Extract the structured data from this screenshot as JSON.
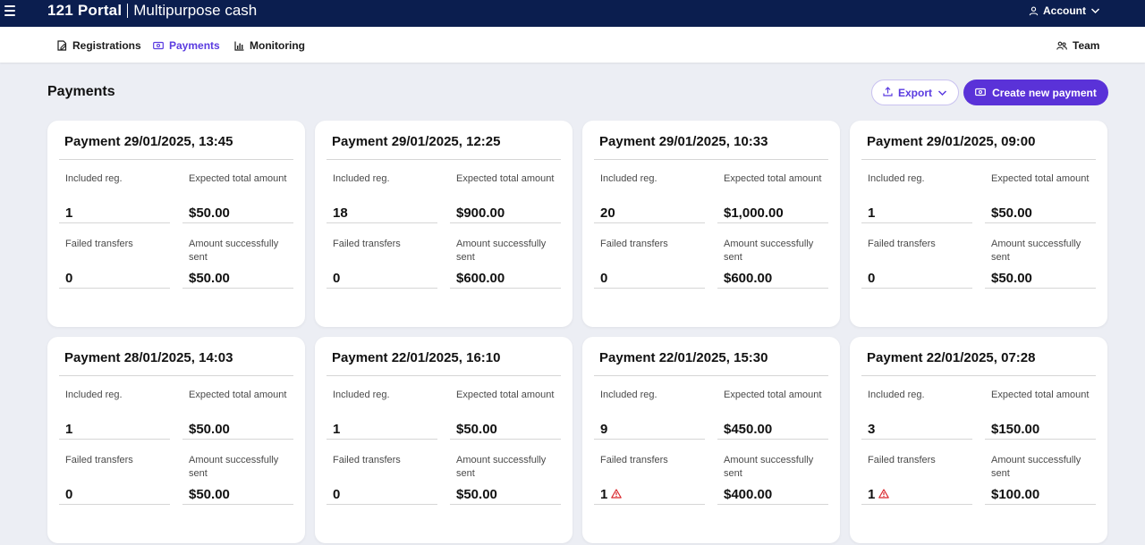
{
  "app": {
    "name": "121 Portal",
    "program": "Multipurpose cash",
    "account_label": "Account"
  },
  "nav": {
    "items": [
      {
        "label": "Registrations",
        "icon": "registrations-icon"
      },
      {
        "label": "Payments",
        "icon": "payments-icon",
        "active": true
      },
      {
        "label": "Monitoring",
        "icon": "monitoring-icon"
      }
    ],
    "team_label": "Team"
  },
  "page": {
    "title": "Payments",
    "export_label": "Export",
    "create_label": "Create new payment"
  },
  "colors": {
    "header_bg": "#0b1e4f",
    "accent": "#5a32d8",
    "warning": "#d9262c"
  },
  "labels": {
    "included": "Included reg.",
    "expected": "Expected total amount",
    "failed": "Failed transfers",
    "sent": "Amount successfully sent"
  },
  "payments": [
    {
      "title": "Payment 29/01/2025, 13:45",
      "included": "1",
      "expected": "$50.00",
      "failed": "0",
      "failed_warning": false,
      "sent": "$50.00"
    },
    {
      "title": "Payment 29/01/2025, 12:25",
      "included": "18",
      "expected": "$900.00",
      "failed": "0",
      "failed_warning": false,
      "sent": "$600.00"
    },
    {
      "title": "Payment 29/01/2025, 10:33",
      "included": "20",
      "expected": "$1,000.00",
      "failed": "0",
      "failed_warning": false,
      "sent": "$600.00"
    },
    {
      "title": "Payment 29/01/2025, 09:00",
      "included": "1",
      "expected": "$50.00",
      "failed": "0",
      "failed_warning": false,
      "sent": "$50.00"
    },
    {
      "title": "Payment 28/01/2025, 14:03",
      "included": "1",
      "expected": "$50.00",
      "failed": "0",
      "failed_warning": false,
      "sent": "$50.00"
    },
    {
      "title": "Payment 22/01/2025, 16:10",
      "included": "1",
      "expected": "$50.00",
      "failed": "0",
      "failed_warning": false,
      "sent": "$50.00"
    },
    {
      "title": "Payment 22/01/2025, 15:30",
      "included": "9",
      "expected": "$450.00",
      "failed": "1",
      "failed_warning": true,
      "sent": "$400.00"
    },
    {
      "title": "Payment 22/01/2025, 07:28",
      "included": "3",
      "expected": "$150.00",
      "failed": "1",
      "failed_warning": true,
      "sent": "$100.00"
    }
  ]
}
